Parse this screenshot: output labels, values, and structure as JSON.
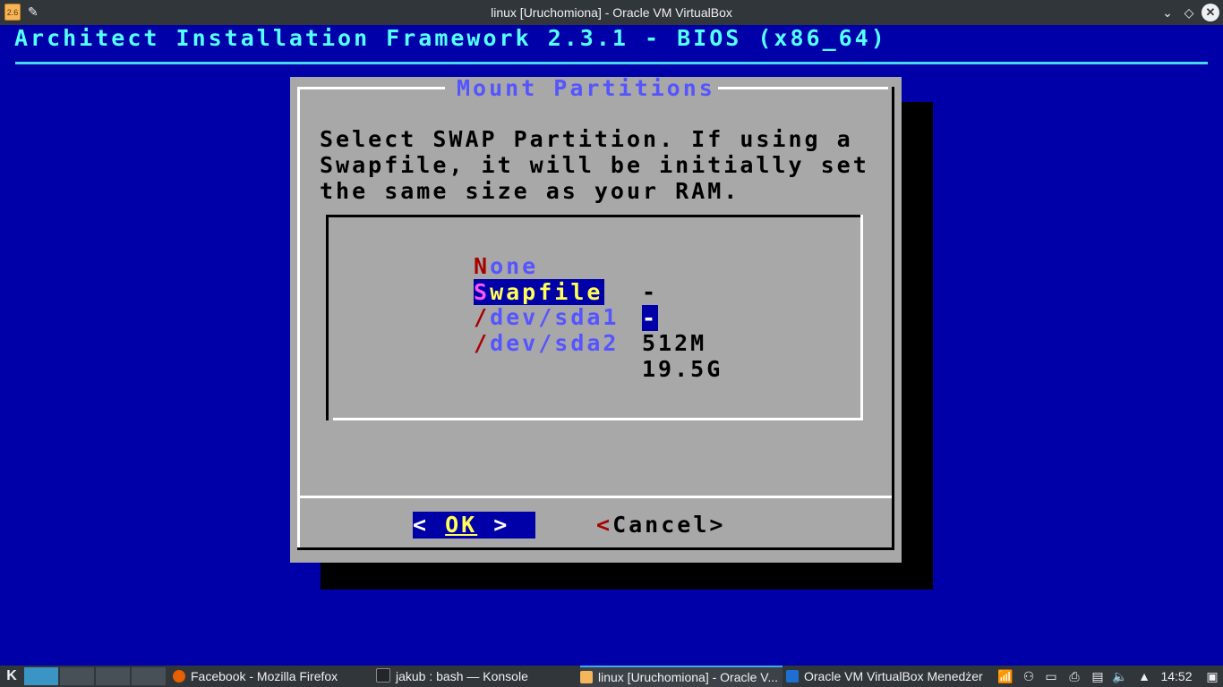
{
  "window": {
    "title": "linux [Uruchomiona] - Oracle VM VirtualBox",
    "app_icon_text": "2.6"
  },
  "installer": {
    "backtitle": "Architect Installation Framework 2.3.1 - BIOS (x86_64)",
    "dialog_title": "Mount Partitions",
    "prompt": "Select SWAP Partition. If using a\nSwapfile, it will be initially set\nthe same size as your RAM.",
    "items": [
      {
        "hot": "N",
        "rest": "one",
        "value": "-",
        "selected": false
      },
      {
        "hot": "S",
        "rest": "wapfile",
        "value": "-",
        "selected": true
      },
      {
        "hot": "/",
        "rest": "dev/sda1",
        "value": "512M",
        "selected": false
      },
      {
        "hot": "/",
        "rest": "dev/sda2",
        "value": "19.5G",
        "selected": false
      }
    ],
    "ok_left": "< ",
    "ok_label": "OK",
    "ok_right": " >",
    "cancel_first": "<",
    "cancel_rest": "Cancel>"
  },
  "taskbar": {
    "tasks": [
      {
        "label": "Facebook - Mozilla Firefox",
        "icon_color": "#e66000"
      },
      {
        "label": "jakub : bash — Konsole",
        "icon_color": "#232629"
      },
      {
        "label": "linux [Uruchomiona] - Oracle V...",
        "icon_color": "#f4b65a"
      },
      {
        "label": "Oracle VM VirtualBox Menedżer",
        "icon_color": "#1f6fd2"
      }
    ],
    "clock": "14:52"
  }
}
